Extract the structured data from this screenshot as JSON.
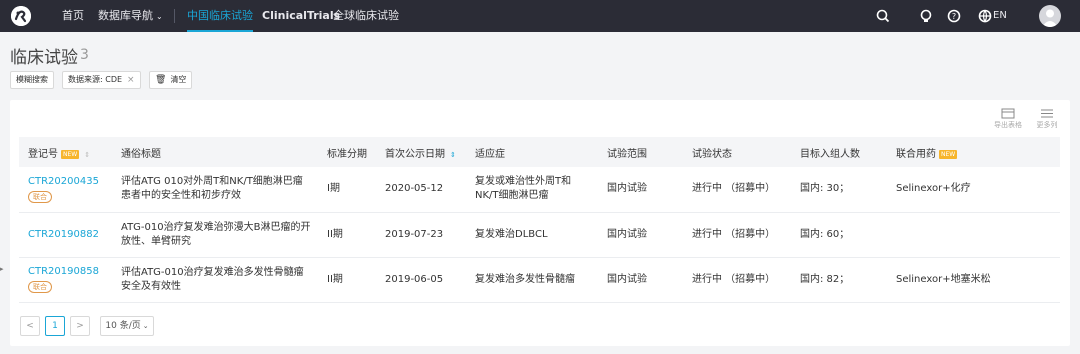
{
  "nav": {
    "items": [
      {
        "label": "首页"
      },
      {
        "label": "数据库导航"
      },
      {
        "label": "中国临床试验"
      },
      {
        "label": "ClinicalTrials"
      },
      {
        "label": "全球临床试验"
      }
    ],
    "lang": "EN"
  },
  "page": {
    "title": "临床试验",
    "count": "3"
  },
  "filters": {
    "fuzzy": "模糊搜索",
    "source": "数据来源: CDE",
    "clear": "清空"
  },
  "toolbar": {
    "export": "导出表格",
    "more": "更多列"
  },
  "table": {
    "headers": {
      "reg": "登记号",
      "title": "通俗标题",
      "phase": "标准分期",
      "date": "首次公示日期",
      "indication": "适应症",
      "scope": "试验范围",
      "status": "试验状态",
      "target": "目标入组人数",
      "combo": "联合用药"
    },
    "new_badge": "NEW",
    "rows": [
      {
        "reg": "CTR20200435",
        "tag": "联合",
        "title": "评估ATG 010对外周T和NK/T细胞淋巴瘤患者中的安全性和初步疗效",
        "phase": "I期",
        "date": "2020-05-12",
        "indication": "复发或难治性外周T和NK/T细胞淋巴瘤",
        "scope": "国内试验",
        "status": "进行中 （招募中）",
        "target": "国内: 30；",
        "combo": "Selinexor+化疗"
      },
      {
        "reg": "CTR20190882",
        "tag": "",
        "title": "ATG-010治疗复发难治弥漫大B淋巴瘤的开放性、单臂研究",
        "phase": "II期",
        "date": "2019-07-23",
        "indication": "复发难治DLBCL",
        "scope": "国内试验",
        "status": "进行中 （招募中）",
        "target": "国内: 60；",
        "combo": ""
      },
      {
        "reg": "CTR20190858",
        "tag": "联合",
        "title": "评估ATG-010治疗复发难治多发性骨髓瘤安全及有效性",
        "phase": "II期",
        "date": "2019-06-05",
        "indication": "复发难治多发性骨髓瘤",
        "scope": "国内试验",
        "status": "进行中 （招募中）",
        "target": "国内: 82；",
        "combo": "Selinexor+地塞米松"
      }
    ]
  },
  "pager": {
    "prev": "<",
    "page": "1",
    "next": ">",
    "size": "10 条/页"
  }
}
